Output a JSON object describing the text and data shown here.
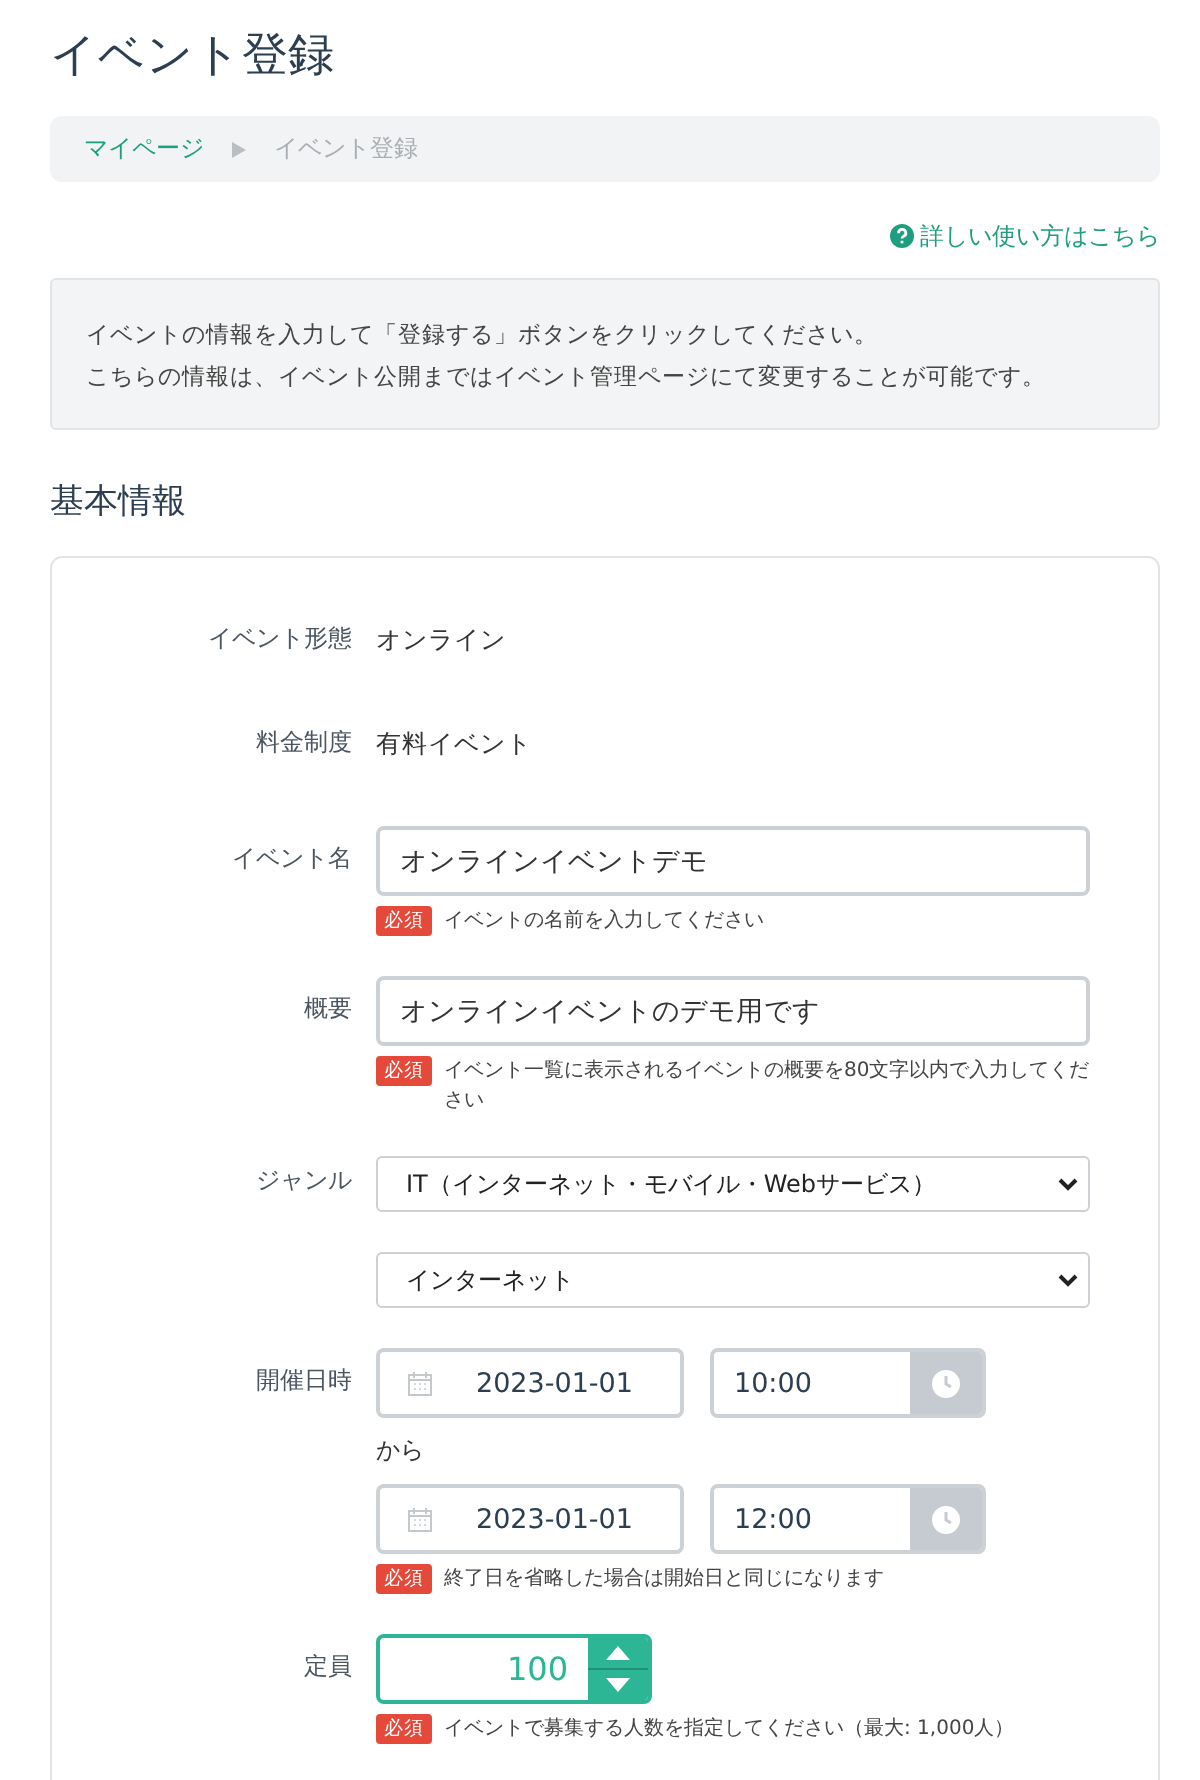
{
  "page_title": "イベント登録",
  "breadcrumb": [
    {
      "label": "マイページ",
      "selected": false
    },
    {
      "label": "イベント登録",
      "selected": true
    }
  ],
  "help_link": "詳しい使い方はこちら",
  "notice": [
    "イベントの情報を入力して「登録する」ボタンをクリックしてください。",
    "こちらの情報は、イベント公開まではイベント管理ページにて変更することが可能です。"
  ],
  "section_title": "基本情報",
  "fields": [
    {
      "kind": "text",
      "label": "イベント形態",
      "value": "オンライン"
    },
    {
      "kind": "text",
      "label": "料金制度",
      "value": "有料イベント"
    },
    {
      "kind": "input",
      "label": "イベント名",
      "value": "オンラインイベントデモ",
      "badge": "必須",
      "help": "イベントの名前を入力してください"
    },
    {
      "kind": "input",
      "label": "概要",
      "value": "オンラインイベントのデモ用です",
      "badge": "必須",
      "help": "イベント一覧に表示されるイベントの概要を80文字以内で入力してください"
    },
    {
      "kind": "select",
      "label": "ジャンル",
      "value": "IT（インターネット・モバイル・Webサービス）"
    },
    {
      "kind": "select",
      "value": "インターネット"
    },
    {
      "kind": "datetime",
      "label": "開催日時",
      "start_date": "2023-01-01",
      "start_time": "10:00",
      "separator": "から",
      "end_date": "2023-01-01",
      "end_time": "12:00",
      "badge": "必須",
      "help": "終了日を省略した場合は開始日と同じになります"
    },
    {
      "kind": "number",
      "label": "定員",
      "value": "100",
      "focused": true,
      "badge": "必須",
      "help": "イベントで募集する人数を指定してください（最大: 1,000人）"
    }
  ]
}
